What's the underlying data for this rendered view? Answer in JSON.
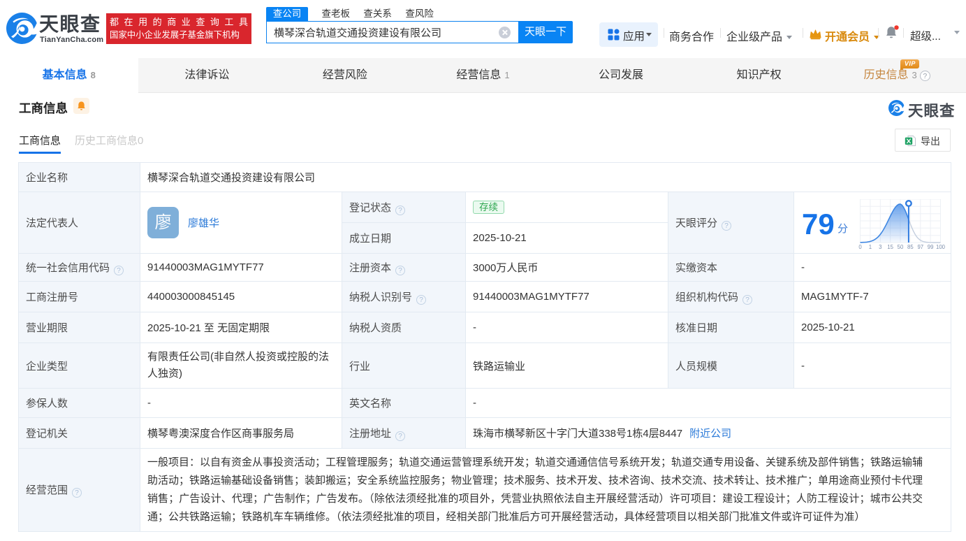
{
  "header": {
    "logo": {
      "name": "天眼查",
      "domain": "TianYanCha.com"
    },
    "slogan": {
      "line1": "都在用的商业查询工具",
      "line2": "国家中小企业发展子基金旗下机构"
    },
    "search": {
      "tabs": [
        {
          "label": "查公司"
        },
        {
          "label": "查老板"
        },
        {
          "label": "查关系"
        },
        {
          "label": "查风险"
        }
      ],
      "value": "横琴深合轨道交通投资建设有限公司",
      "button": "天眼一下"
    },
    "nav": {
      "apps": "应用",
      "cooperation": "商务合作",
      "enterprise": "企业级产品",
      "membership": "开通会员",
      "account": "超级..."
    }
  },
  "tabs": [
    {
      "label": "基本信息",
      "count": "8"
    },
    {
      "label": "法律诉讼",
      "count": ""
    },
    {
      "label": "经营风险",
      "count": ""
    },
    {
      "label": "经营信息",
      "count": "1"
    },
    {
      "label": "公司发展",
      "count": ""
    },
    {
      "label": "知识产权",
      "count": ""
    },
    {
      "label": "历史信息",
      "count": "3",
      "vip": "VIP"
    }
  ],
  "section": {
    "title": "工商信息",
    "watermark": "天眼查",
    "subtabs": [
      {
        "label": "工商信息"
      },
      {
        "label": "历史工商信息0"
      }
    ],
    "export": "导出"
  },
  "company": {
    "name_label": "企业名称",
    "name": "横琴深合轨道交通投资建设有限公司",
    "legal_rep_label": "法定代表人",
    "legal_rep": "廖雄华",
    "legal_rep_avatar": "廖",
    "reg_status_label": "登记状态",
    "reg_status": "存续",
    "establish_date_label": "成立日期",
    "establish_date": "2025-10-21",
    "score_label": "天眼评分",
    "credit_code_label": "统一社会信用代码",
    "credit_code": "91440003MAG1MYTF77",
    "reg_capital_label": "注册资本",
    "reg_capital": "3000万人民币",
    "paid_capital_label": "实缴资本",
    "paid_capital": "-",
    "reg_number_label": "工商注册号",
    "reg_number": "440003000845145",
    "taxpayer_id_label": "纳税人识别号",
    "taxpayer_id": "91440003MAG1MYTF77",
    "org_code_label": "组织机构代码",
    "org_code": "MAG1MYTF-7",
    "business_term_label": "营业期限",
    "business_term": "2025-10-21 至 无固定期限",
    "taxpayer_quality_label": "纳税人资质",
    "taxpayer_quality": "-",
    "approval_date_label": "核准日期",
    "approval_date": "2025-10-21",
    "company_type_label": "企业类型",
    "company_type": "有限责任公司(非自然人投资或控股的法人独资)",
    "industry_label": "行业",
    "industry": "铁路运输业",
    "staff_size_label": "人员规模",
    "staff_size": "-",
    "insured_label": "参保人数",
    "insured": "-",
    "english_name_label": "英文名称",
    "english_name": "-",
    "reg_authority_label": "登记机关",
    "reg_authority": "横琴粤澳深度合作区商事服务局",
    "address_label": "注册地址",
    "address": "珠海市横琴新区十字门大道338号1栋4层8447",
    "address_link": "附近公司",
    "business_scope_label": "经营范围",
    "business_scope": "一般项目：以自有资金从事投资活动；工程管理服务；轨道交通运营管理系统开发；轨道交通通信信号系统开发；轨道交通专用设备、关键系统及部件销售；铁路运输辅助活动；铁路运输基础设备销售；装卸搬运；安全系统监控服务；物业管理；技术服务、技术开发、技术咨询、技术交流、技术转让、技术推广；单用途商业预付卡代理销售；广告设计、代理；广告制作；广告发布。（除依法须经批准的项目外，凭营业执照依法自主开展经营活动）许可项目：建设工程设计；人防工程设计；城市公共交通；公共铁路运输；铁路机车车辆维修。（依法须经批准的项目，经相关部门批准后方可开展经营活动，具体经营项目以相关部门批准文件或许可证件为准）"
  },
  "chart_data": {
    "type": "area",
    "title": "天眼评分",
    "score": "79",
    "score_unit": "分",
    "x_ticks": [
      "0",
      "1",
      "3",
      "15",
      "50",
      "85",
      "97",
      "99",
      "100"
    ],
    "marker_value": 79,
    "xlabel": "",
    "ylabel": "",
    "description": "skewed bell distribution curve of company scores, blue filled left of marker pin at score 79, gray line right of marker"
  }
}
